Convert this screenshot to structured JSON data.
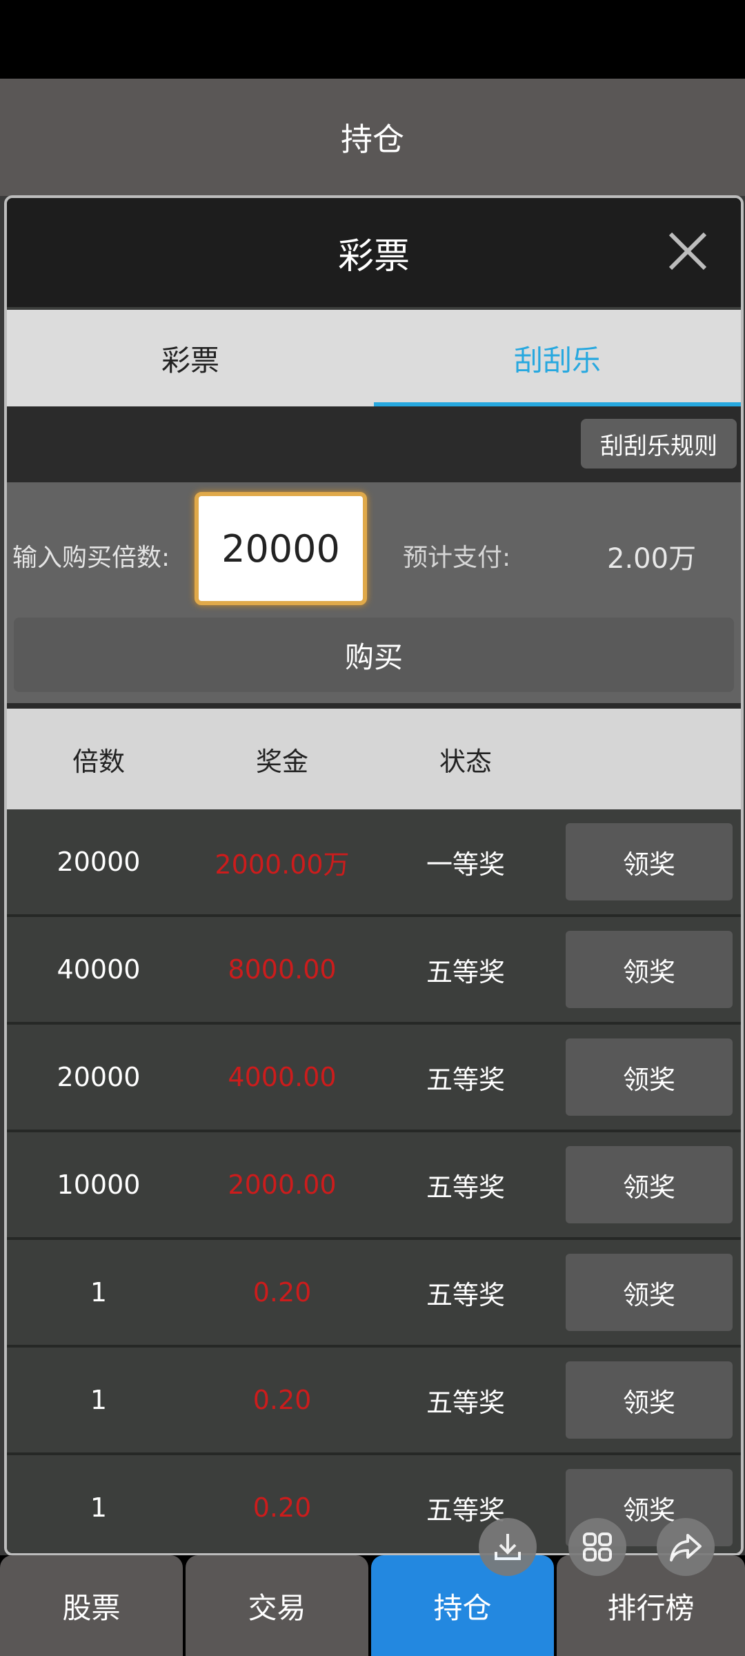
{
  "header": {
    "title": "持仓"
  },
  "dialog": {
    "title": "彩票",
    "tabs": [
      {
        "label": "彩票",
        "active": false
      },
      {
        "label": "刮刮乐",
        "active": true
      }
    ],
    "rules_label": "刮刮乐规则",
    "buy": {
      "multiplier_label": "输入购买倍数:",
      "multiplier_value": "20000",
      "pay_label": "预计支付:",
      "pay_value": "2.00万",
      "buy_label": "购买"
    },
    "table": {
      "headers": [
        "倍数",
        "奖金",
        "状态",
        ""
      ],
      "rows": [
        {
          "multiple": "20000",
          "prize": "2000.00万",
          "status": "一等奖",
          "action": "领奖"
        },
        {
          "multiple": "40000",
          "prize": "8000.00",
          "status": "五等奖",
          "action": "领奖"
        },
        {
          "multiple": "20000",
          "prize": "4000.00",
          "status": "五等奖",
          "action": "领奖"
        },
        {
          "multiple": "10000",
          "prize": "2000.00",
          "status": "五等奖",
          "action": "领奖"
        },
        {
          "multiple": "1",
          "prize": "0.20",
          "status": "五等奖",
          "action": "领奖"
        },
        {
          "multiple": "1",
          "prize": "0.20",
          "status": "五等奖",
          "action": "领奖"
        },
        {
          "multiple": "1",
          "prize": "0.20",
          "status": "五等奖",
          "action": "领奖"
        }
      ]
    }
  },
  "bottom_nav": [
    {
      "label": "股票",
      "active": false
    },
    {
      "label": "交易",
      "active": false
    },
    {
      "label": "持仓",
      "active": true
    },
    {
      "label": "排行榜",
      "active": false
    }
  ],
  "floating_actions": [
    {
      "icon": "download-icon"
    },
    {
      "icon": "apps-grid-icon"
    },
    {
      "icon": "share-icon"
    }
  ],
  "colors": {
    "accent": "#27a8df",
    "active_nav": "#2388e0",
    "prize_red": "#cc1c1c",
    "input_border": "#e0a94a"
  }
}
